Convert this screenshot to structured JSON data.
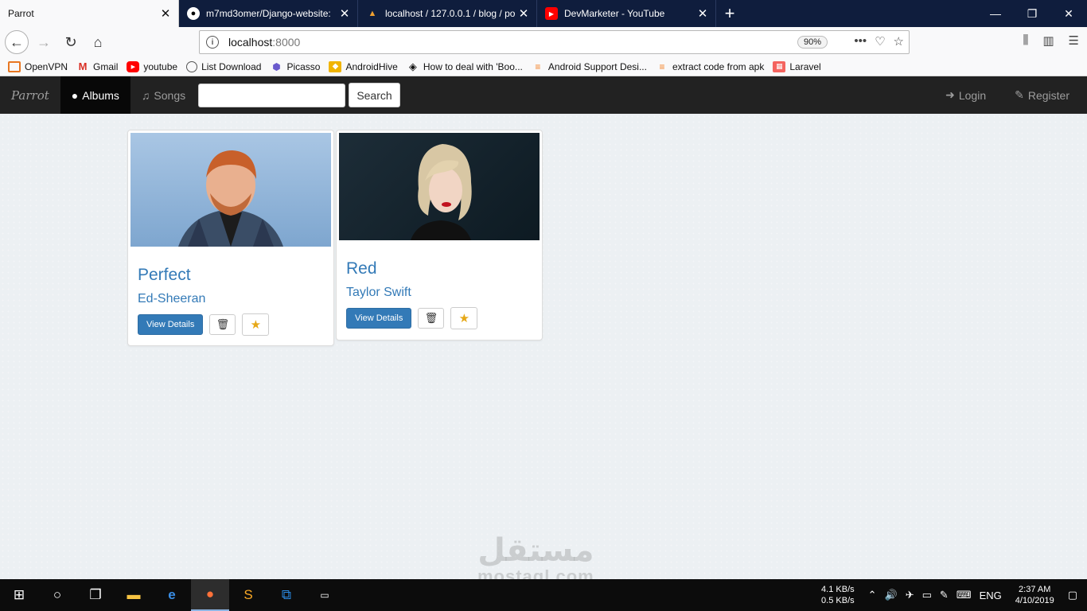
{
  "browser": {
    "tabs": [
      {
        "title": "Parrot",
        "active": true,
        "icon": "none"
      },
      {
        "title": "m7md3omer/Django-website:",
        "active": false,
        "icon": "github-icon"
      },
      {
        "title": "localhost / 127.0.0.1 / blog / po",
        "active": false,
        "icon": "phpmyadmin-icon"
      },
      {
        "title": "DevMarketer - YouTube",
        "active": false,
        "icon": "youtube-icon"
      }
    ],
    "url_host": "localhost",
    "url_port": ":8000",
    "zoom": "90%",
    "bookmarks": [
      {
        "label": "OpenVPN",
        "icon": "openvpn-icon",
        "color": "#e87722"
      },
      {
        "label": "Gmail",
        "icon": "gmail-icon",
        "color": "#d93025"
      },
      {
        "label": "youtube",
        "icon": "youtube-icon",
        "color": "#ff0000"
      },
      {
        "label": "List Download",
        "icon": "globe-icon",
        "color": "#555555"
      },
      {
        "label": "Picasso",
        "icon": "picasso-icon",
        "color": "#6a5acd"
      },
      {
        "label": "AndroidHive",
        "icon": "androidhive-icon",
        "color": "#f0b400"
      },
      {
        "label": "How to deal with 'Boo...",
        "icon": "diamond-icon",
        "color": "#333333"
      },
      {
        "label": "Android Support Desi...",
        "icon": "stackoverflow-icon",
        "color": "#f48024"
      },
      {
        "label": "extract code from apk",
        "icon": "stackoverflow-icon",
        "color": "#f48024"
      },
      {
        "label": "Laravel",
        "icon": "laravel-icon",
        "color": "#f4645f"
      }
    ]
  },
  "app": {
    "brand": "Parrot",
    "nav": {
      "albums": "Albums",
      "songs": "Songs"
    },
    "search": {
      "button": "Search",
      "value": ""
    },
    "right": {
      "login": "Login",
      "register": "Register"
    }
  },
  "albums": [
    {
      "title": "Perfect",
      "artist": "Ed-Sheeran",
      "details_label": "View Details"
    },
    {
      "title": "Red",
      "artist": "Taylor Swift",
      "details_label": "View Details"
    }
  ],
  "watermark": {
    "arabic": "مستقل",
    "latin": "mostaql.com"
  },
  "taskbar": {
    "net_down": "4.1 KB/s",
    "net_up": "0.5 KB/s",
    "lang": "ENG",
    "time": "2:37 AM",
    "date": "4/10/2019"
  },
  "colors": {
    "brand_blue": "#337ab7",
    "navbar": "#222222",
    "tab_strip": "#0f1d3d",
    "star": "#e6a817"
  }
}
